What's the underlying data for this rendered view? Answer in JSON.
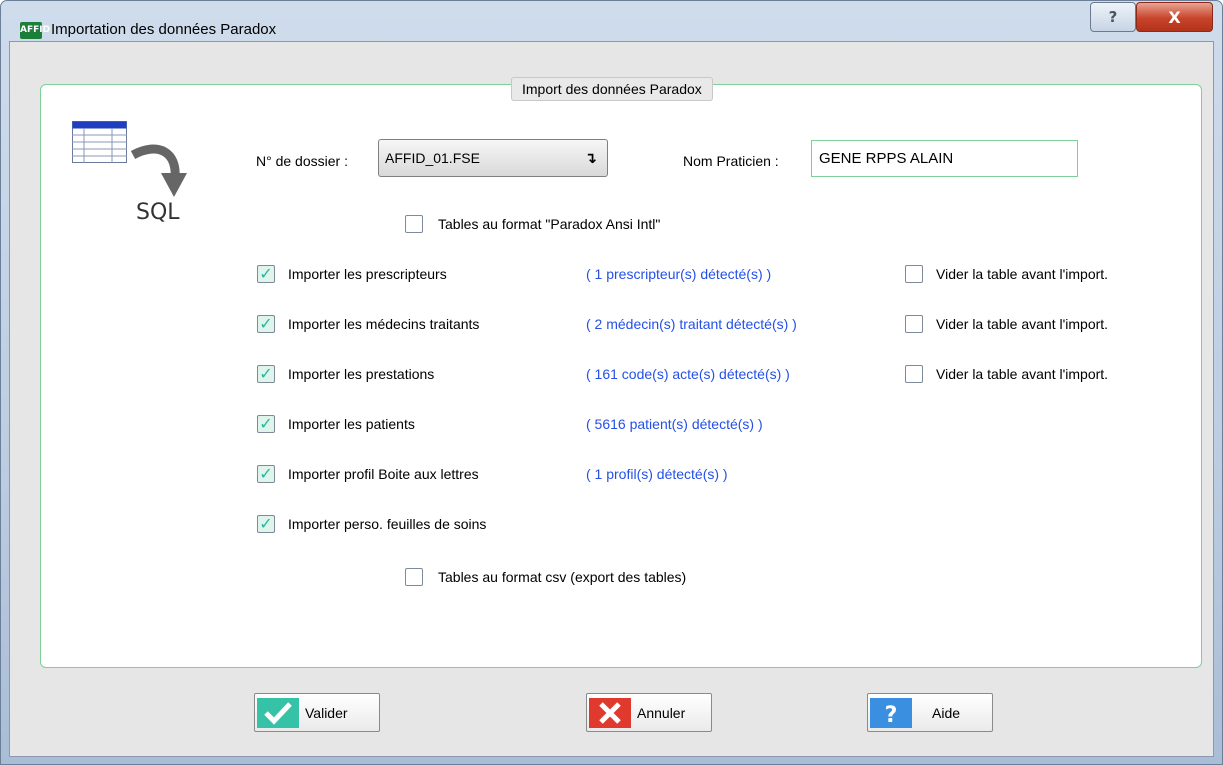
{
  "window": {
    "title": "Importation des données Paradox",
    "app_icon_text": "AFFID",
    "help_label": "?",
    "close_label": "X"
  },
  "group": {
    "legend": "Import des données Paradox"
  },
  "graphic": {
    "sql_label": "SQL"
  },
  "dossier": {
    "label": "N° de dossier :",
    "value": "AFFID_01.FSE"
  },
  "praticien": {
    "label": "Nom Praticien :",
    "value": "GENE RPPS ALAIN"
  },
  "paradox_ansi": {
    "label": "Tables au format \"Paradox Ansi Intl\"",
    "checked": false
  },
  "imports": [
    {
      "label": "Importer les prescripteurs",
      "detected": "( 1 prescripteur(s) détecté(s) )",
      "checked": true,
      "vider": "Vider la table avant l'import.",
      "vider_checked": false
    },
    {
      "label": "Importer les médecins traitants",
      "detected": "( 2 médecin(s) traitant détecté(s) )",
      "checked": true,
      "vider": "Vider la table avant l'import.",
      "vider_checked": false
    },
    {
      "label": "Importer les prestations",
      "detected": "( 161 code(s) acte(s) détecté(s) )",
      "checked": true,
      "vider": "Vider la table avant l'import.",
      "vider_checked": false
    },
    {
      "label": "Importer les patients",
      "detected": "( 5616 patient(s) détecté(s) )",
      "checked": true
    },
    {
      "label": "Importer profil Boite aux lettres",
      "detected": "( 1 profil(s) détecté(s) )",
      "checked": true
    },
    {
      "label": "Importer perso. feuilles de soins",
      "checked": true
    }
  ],
  "csv": {
    "label": "Tables au format csv (export des tables)",
    "checked": false
  },
  "buttons": {
    "valider": "Valider",
    "annuler": "Annuler",
    "aide": "Aide"
  },
  "colors": {
    "detected_text": "#2450e8",
    "group_border": "#7fcf9a",
    "check_mark": "#2bb3a0"
  }
}
